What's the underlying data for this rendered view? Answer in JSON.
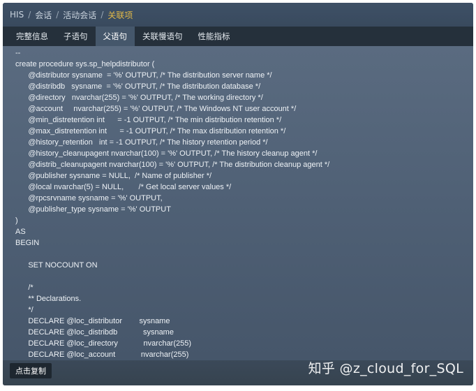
{
  "breadcrumb": {
    "items": [
      "HIS",
      "会话",
      "活动会话",
      "关联项"
    ],
    "separator": "/"
  },
  "tabs": [
    {
      "label": "完整信息",
      "active": false
    },
    {
      "label": "子语句",
      "active": false
    },
    {
      "label": "父语句",
      "active": true
    },
    {
      "label": "关联慢语句",
      "active": false
    },
    {
      "label": "性能指标",
      "active": false
    }
  ],
  "code_lines": [
    "--",
    "create procedure sys.sp_helpdistributor (",
    "      @distributor sysname  = '%' OUTPUT, /* The distribution server name */",
    "      @distribdb   sysname  = '%' OUTPUT, /* The distribution database */",
    "      @directory   nvarchar(255) = '%' OUTPUT, /* The working directory */",
    "      @account     nvarchar(255) = '%' OUTPUT, /* The Windows NT user account */",
    "      @min_distretention int      = -1 OUTPUT, /* The min distribution retention */",
    "      @max_distretention int      = -1 OUTPUT, /* The max distribution retention */",
    "      @history_retention   int = -1 OUTPUT, /* The history retention period */",
    "      @history_cleanupagent nvarchar(100) = '%' OUTPUT, /* The history cleanup agent */",
    "      @distrib_cleanupagent nvarchar(100) = '%' OUTPUT, /* The distribution cleanup agent */",
    "      @publisher sysname = NULL,  /* Name of publisher */",
    "      @local nvarchar(5) = NULL,       /* Get local server values */",
    "      @rpcsrvname sysname = '%' OUTPUT,",
    "      @publisher_type sysname = '%' OUTPUT",
    ")",
    "AS",
    "BEGIN",
    "",
    "      SET NOCOUNT ON",
    "",
    "      /*",
    "      ** Declarations.",
    "      */",
    "      DECLARE @loc_distributor        sysname",
    "      DECLARE @loc_distribdb            sysname",
    "      DECLARE @loc_directory            nvarchar(255)",
    "      DECLARE @loc_account            nvarchar(255)"
  ],
  "footer": {
    "copy_label": "点击复制",
    "watermark": "知乎 @z_cloud_for_SQL"
  }
}
